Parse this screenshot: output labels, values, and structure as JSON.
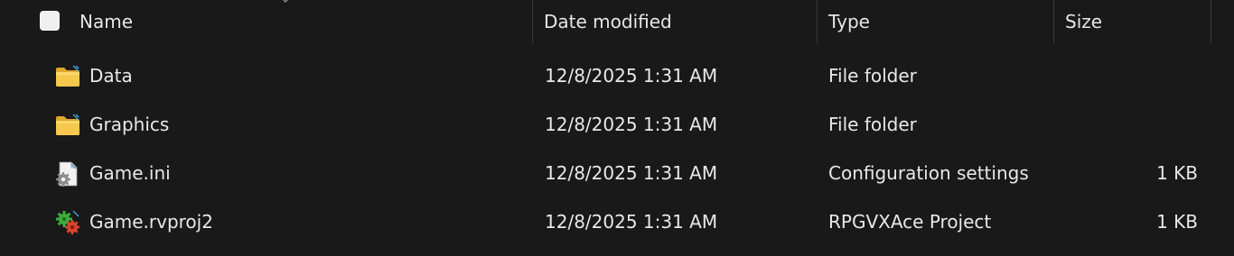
{
  "columns": {
    "name": "Name",
    "date_modified": "Date modified",
    "type": "Type",
    "size": "Size"
  },
  "files": [
    {
      "name": "Data",
      "date": "12/8/2025 1:31 AM",
      "type": "File folder",
      "size": "",
      "icon": "folder-icon"
    },
    {
      "name": "Graphics",
      "date": "12/8/2025 1:31 AM",
      "type": "File folder",
      "size": "",
      "icon": "folder-icon"
    },
    {
      "name": "Game.ini",
      "date": "12/8/2025 1:31 AM",
      "type": "Configuration settings",
      "size": "1 KB",
      "icon": "config-file-icon"
    },
    {
      "name": "Game.rvproj2",
      "date": "12/8/2025 1:31 AM",
      "type": "RPGVXAce Project",
      "size": "1 KB",
      "icon": "rpgmaker-project-icon"
    }
  ],
  "colors": {
    "background": "#191919",
    "text": "#e8e8e8",
    "folder": "#f3c54b",
    "separator": "#3b3b3b"
  }
}
